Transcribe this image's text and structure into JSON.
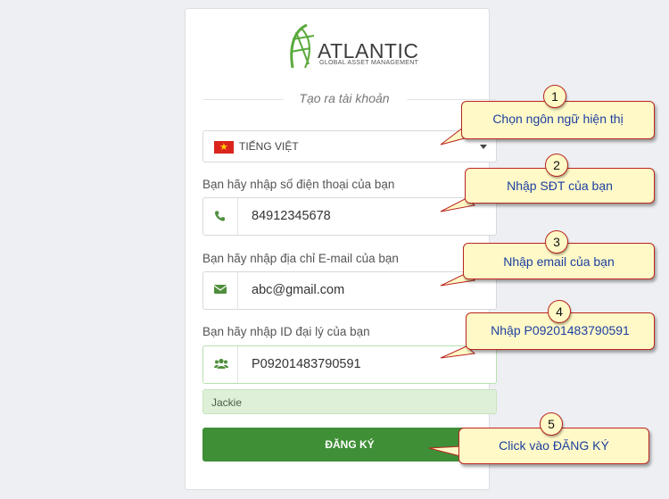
{
  "logo": {
    "brand": "ATLANTIC",
    "sub": "GLOBAL ASSET MANAGEMENT"
  },
  "form": {
    "title": "Tạo ra tài khoản",
    "language": "TIẾNG VIỆT",
    "phone_label": "Bạn hãy nhập số điện thoại của bạn",
    "phone_value": "84912345678",
    "email_label": "Bạn hãy nhập địa chỉ E-mail của bạn",
    "email_value": "abc@gmail.com",
    "agent_label": "Bạn hãy nhập ID đại lý của bạn",
    "agent_value": "P09201483790591",
    "agent_suggestion": "Jackie",
    "submit_label": "ĐĂNG KÝ"
  },
  "callouts": [
    {
      "number": "1",
      "text": "Chọn ngôn ngữ hiện thị"
    },
    {
      "number": "2",
      "text": "Nhập SĐT của bạn"
    },
    {
      "number": "3",
      "text": "Nhập email của bạn"
    },
    {
      "number": "4",
      "text": "Nhập P09201483790591"
    },
    {
      "number": "5",
      "text": "Click vào ĐĂNG KÝ"
    }
  ],
  "colors": {
    "accent_green": "#3f8f37",
    "callout_bg": "#fff9c7",
    "callout_border": "#b9261e",
    "callout_text": "#1d3fa0"
  },
  "icons": [
    "phone-icon",
    "envelope-icon",
    "users-icon",
    "vietnam-flag-icon",
    "caret-down-icon"
  ]
}
